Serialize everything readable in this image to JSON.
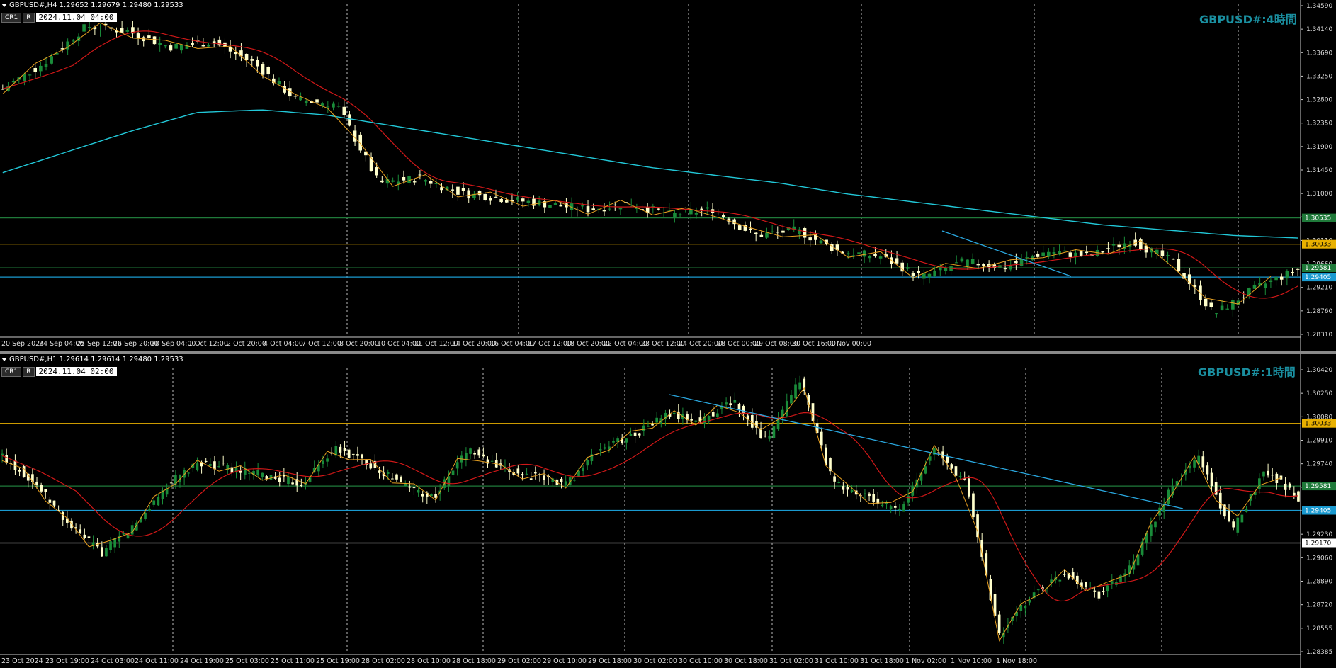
{
  "top_chart": {
    "symbol_header": "GBPUSD#,H4  1.29652 1.29679 1.29480 1.29533",
    "tag1": "CR1",
    "tag2": "R",
    "date_box": "2024.11.04 04:00",
    "corner_label": "GBPUSD#:4時間",
    "price_labels": [
      "1.34590",
      "1.34140",
      "1.33690",
      "1.33250",
      "1.32800",
      "1.32350",
      "1.31900",
      "1.31450",
      "1.31000",
      "1.30560",
      "1.30110",
      "1.29660",
      "1.29210",
      "1.28760",
      "1.28310"
    ],
    "hline_labels": [
      "1.30535",
      "1.30033",
      "1.29581",
      "1.29405"
    ],
    "time_labels": [
      "20 Sep 2024",
      "24 Sep 04:00",
      "25 Sep 12:00",
      "26 Sep 20:00",
      "30 Sep 04:00",
      "1 Oct 12:00",
      "2 Oct 20:00",
      "4 Oct 04:00",
      "7 Oct 12:00",
      "8 Oct 20:00",
      "10 Oct 04:00",
      "11 Oct 12:00",
      "14 Oct 20:00",
      "16 Oct 04:00",
      "17 Oct 12:00",
      "18 Oct 20:00",
      "22 Oct 04:00",
      "23 Oct 12:00",
      "24 Oct 20:00",
      "28 Oct 00:00",
      "29 Oct 08:00",
      "30 Oct 16:00",
      "1 Nov 00:00"
    ]
  },
  "bottom_chart": {
    "symbol_header": "GBPUSD#,H1  1.29614 1.29614 1.29480 1.29533",
    "tag1": "CR1",
    "tag2": "R",
    "date_box": "2024.11.04 02:00",
    "corner_label": "GBPUSD#:1時間",
    "price_labels": [
      "1.30420",
      "1.30250",
      "1.30080",
      "1.29910",
      "1.29740",
      "1.29570",
      "1.29400",
      "1.29230",
      "1.29060",
      "1.28890",
      "1.28720",
      "1.28555",
      "1.28385"
    ],
    "hline_labels": [
      "1.30033",
      "1.29581",
      "1.29405",
      "1.29170"
    ],
    "time_labels": [
      "23 Oct 2024",
      "23 Oct 19:00",
      "24 Oct 03:00",
      "24 Oct 11:00",
      "24 Oct 19:00",
      "25 Oct 03:00",
      "25 Oct 11:00",
      "25 Oct 19:00",
      "28 Oct 02:00",
      "28 Oct 10:00",
      "28 Oct 18:00",
      "29 Oct 02:00",
      "29 Oct 10:00",
      "29 Oct 18:00",
      "30 Oct 02:00",
      "30 Oct 10:00",
      "30 Oct 18:00",
      "31 Oct 02:00",
      "31 Oct 10:00",
      "31 Oct 18:00",
      "1 Nov 02:00",
      "1 Nov 10:00",
      "1 Nov 18:00"
    ]
  },
  "colors": {
    "bull": "#1a8c3a",
    "bear": "#ffffcc",
    "ma_fast": "#d01818",
    "ma_slow": "#22c8d8",
    "zigzag": "#e8a020",
    "resistance": "#e8b000",
    "support": "#1a9ad0",
    "green_level": "#1f7a3a",
    "white_level": "#ffffff",
    "trendline": "#2aa8e0"
  }
}
